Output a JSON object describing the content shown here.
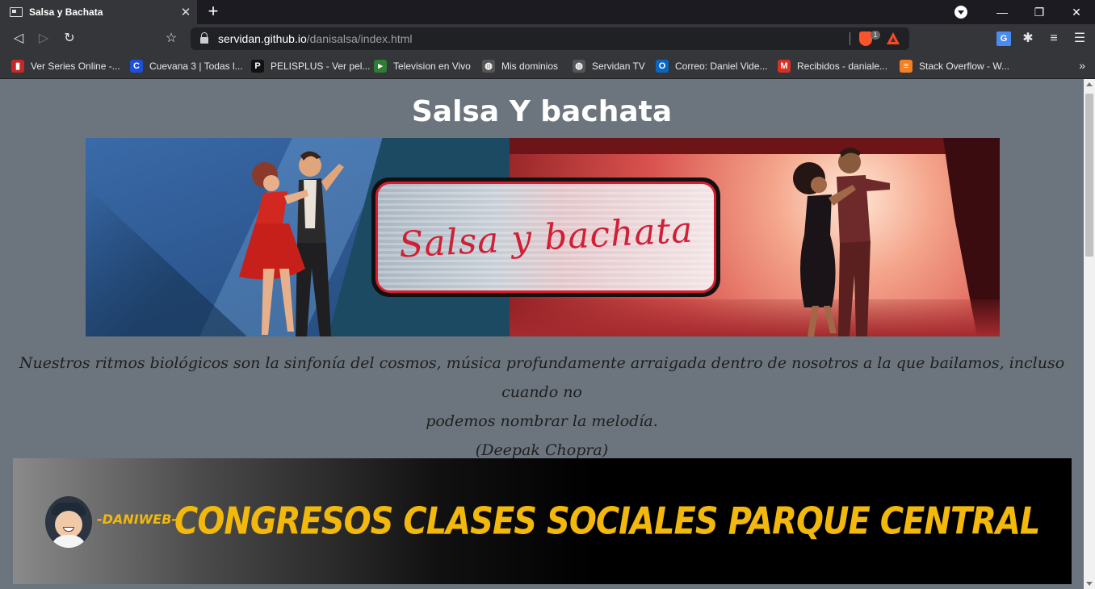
{
  "browser": {
    "tab": {
      "title": "Salsa y Bachata",
      "close_icon": "✕"
    },
    "new_tab_icon": "+",
    "window_controls": {
      "minimize": "—",
      "maximize": "❐",
      "close": "✕"
    },
    "nav": {
      "back": "◁",
      "forward": "▷",
      "reload": "↻",
      "bookmark": "☆"
    },
    "url": {
      "host": "servidan.github.io",
      "path": "/danisalsa/index.html"
    },
    "brave_badge": "1",
    "extensions": {
      "translate": "G",
      "puzzle": "✱",
      "playlist": "≡",
      "menu": "☰"
    },
    "bookmarks": [
      {
        "label": "Ver Series Online -...",
        "icon_color": "#c62828",
        "glyph": "▮"
      },
      {
        "label": "Cuevana 3 | Todas l...",
        "icon_color": "#1e4fd8",
        "glyph": "C"
      },
      {
        "label": "PELISPLUS - Ver pel...",
        "icon_color": "#111111",
        "glyph": "P"
      },
      {
        "label": "Television en Vivo",
        "icon_color": "#2e7d32",
        "glyph": "▸"
      },
      {
        "label": "Mis dominios",
        "icon_color": "#555555",
        "glyph": "◍"
      },
      {
        "label": "Servidan TV",
        "icon_color": "#555555",
        "glyph": "◍"
      },
      {
        "label": "Correo: Daniel Vide...",
        "icon_color": "#0a66c2",
        "glyph": "O"
      },
      {
        "label": "Recibidos - daniale...",
        "icon_color": "#d93025",
        "glyph": "M"
      },
      {
        "label": "Stack Overflow - W...",
        "icon_color": "#f48024",
        "glyph": "≡"
      }
    ],
    "bookmarks_more": "»"
  },
  "page": {
    "title": "Salsa Y bachata",
    "banner_text": "Salsa y bachata",
    "quote_line1": "Nuestros ritmos biológicos son la sinfonía del cosmos, música profundamente arraigada dentro de nosotros a la que bailamos, incluso cuando no",
    "quote_line2": "podemos nombrar la melodía.",
    "quote_author": "(Deepak Chopra)",
    "promo": {
      "brand": "-DANIWEB-",
      "headline": "CONGRESOS CLASES SOCIALES PARQUE CENTRAL",
      "accent": "#f2b80c"
    }
  }
}
